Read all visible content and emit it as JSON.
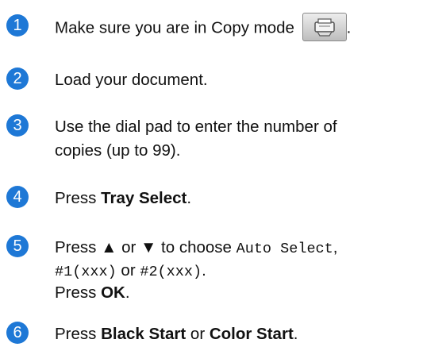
{
  "steps": [
    {
      "n": "1",
      "before": "Make sure you are in Copy mode",
      "after": ".",
      "icon": "copy-mode-icon"
    },
    {
      "n": "2",
      "text": "Load your document."
    },
    {
      "n": "3",
      "line1": "Use the dial pad to enter the number of",
      "line2": "copies (up to 99)."
    },
    {
      "n": "4",
      "pre": "Press ",
      "bold": "Tray Select",
      "post": "."
    },
    {
      "n": "5",
      "press": "Press ",
      "up": "▲",
      "or1": " or ",
      "down": "▼",
      "tochoose": " to choose ",
      "opt1": "Auto Select",
      "comma": ",",
      "opt2": "#1(xxx)",
      "or2": " or ",
      "opt3": "#2(xxx)",
      "dot": ".",
      "press2": "Press ",
      "ok": "OK",
      "dot2": "."
    },
    {
      "n": "6",
      "pre": "Press ",
      "bold1": "Black Start",
      "mid": " or ",
      "bold2": "Color Start",
      "post": "."
    }
  ],
  "colors": {
    "badge": "#1e78d6",
    "text": "#111111"
  }
}
